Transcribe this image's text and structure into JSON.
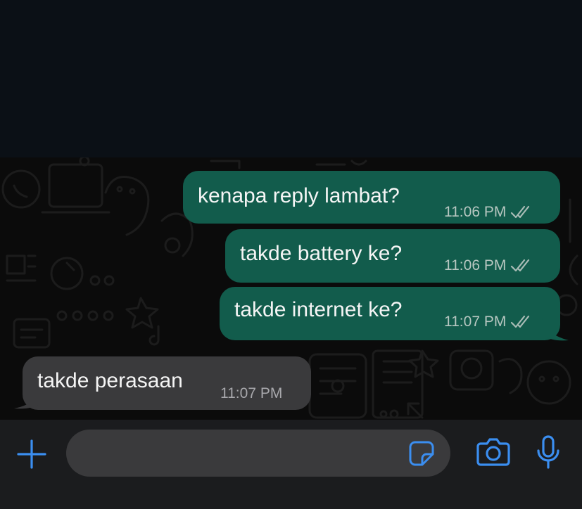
{
  "messages": [
    {
      "direction": "outgoing",
      "text": "kenapa reply lambat?",
      "time": "11:06 PM",
      "status": "read"
    },
    {
      "direction": "outgoing",
      "text": "takde battery ke?",
      "time": "11:06 PM",
      "status": "read"
    },
    {
      "direction": "outgoing",
      "text": "takde internet ke?",
      "time": "11:07 PM",
      "status": "read"
    },
    {
      "direction": "incoming",
      "text": "takde perasaan",
      "time": "11:07 PM"
    }
  ],
  "composer": {
    "placeholder": "",
    "value": "",
    "icons": [
      "plus-icon",
      "sticker-icon",
      "camera-icon",
      "microphone-icon"
    ]
  },
  "colors": {
    "outgoing_bubble": "#125c4c",
    "incoming_bubble": "#3a3a3c",
    "accent": "#3b8ef0",
    "chat_background": "#0b0b0b"
  }
}
